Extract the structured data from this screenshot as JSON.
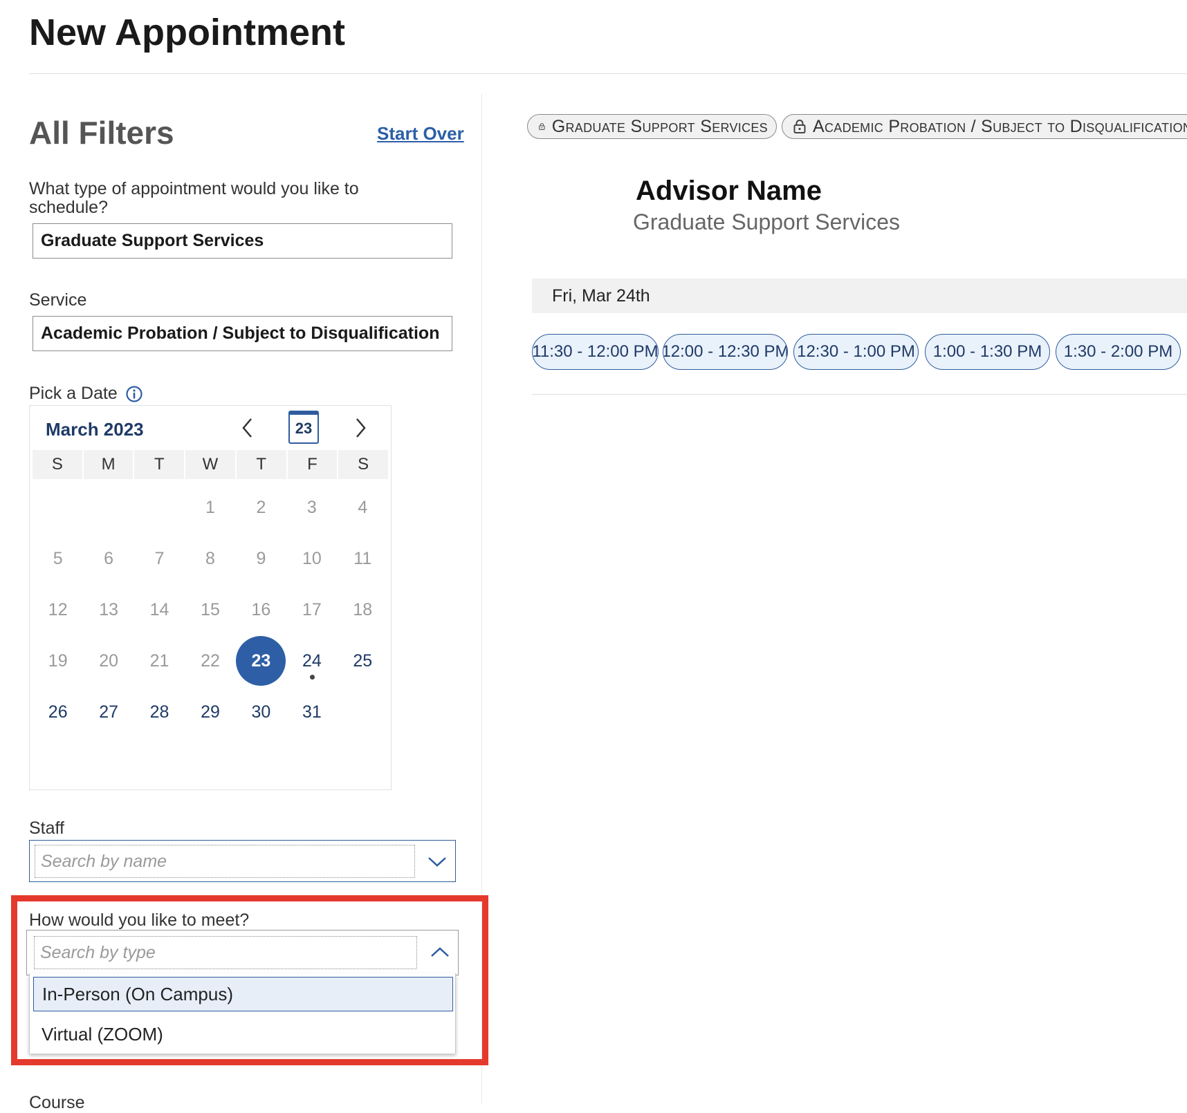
{
  "page": {
    "title": "New Appointment"
  },
  "filters": {
    "title": "All Filters",
    "start_over": "Start Over",
    "appointment_type": {
      "label": "What type of appointment would you like to schedule?",
      "value": "Graduate Support Services"
    },
    "service": {
      "label": "Service",
      "value": "Academic Probation / Subject to Disqualification"
    },
    "date": {
      "label": "Pick a Date",
      "info_icon": "info-circle-icon"
    },
    "staff": {
      "label": "Staff",
      "placeholder": "Search by name",
      "toggle_icon": "chevron-down-icon"
    },
    "meeting": {
      "label": "How would you like to meet?",
      "placeholder": "Search by type",
      "toggle_icon": "chevron-up-icon",
      "options": [
        "In-Person (On Campus)",
        "Virtual (ZOOM)"
      ],
      "active_option": "In-Person (On Campus)"
    },
    "course": {
      "label": "Course"
    }
  },
  "calendar": {
    "month_label": "March 2023",
    "today_button": "23",
    "prev_icon": "chevron-left-icon",
    "next_icon": "chevron-right-icon",
    "weekdays": [
      "S",
      "M",
      "T",
      "W",
      "T",
      "F",
      "S"
    ],
    "leading_blanks": 3,
    "days": [
      "1",
      "2",
      "3",
      "4",
      "5",
      "6",
      "7",
      "8",
      "9",
      "10",
      "11",
      "12",
      "13",
      "14",
      "15",
      "16",
      "17",
      "18",
      "19",
      "20",
      "21",
      "22",
      "23",
      "24",
      "25",
      "26",
      "27",
      "28",
      "29",
      "30",
      "31"
    ],
    "selected_day": "23",
    "marked_days": [
      "24"
    ],
    "available_days": [
      "23",
      "24",
      "25",
      "26",
      "27",
      "28",
      "29",
      "30",
      "31"
    ]
  },
  "results": {
    "active_filters": [
      {
        "label": "Graduate Support Services",
        "icon": "lock-icon"
      },
      {
        "label": "Academic Probation / Subject to Disqualification",
        "icon": "lock-icon"
      }
    ],
    "advisor": {
      "name": "Advisor Name",
      "service": "Graduate Support Services"
    },
    "day_label": "Fri, Mar 24th",
    "time_slots": [
      "11:30 - 12:00 PM",
      "12:00 - 12:30 PM",
      "12:30 - 1:00 PM",
      "1:00 - 1:30 PM",
      "1:30 - 2:00 PM"
    ]
  },
  "colors": {
    "accent": "#2e5fa6",
    "accent_dark": "#1f3a66",
    "highlight": "#e43a2d",
    "slot_bg": "#e9f1fb"
  }
}
